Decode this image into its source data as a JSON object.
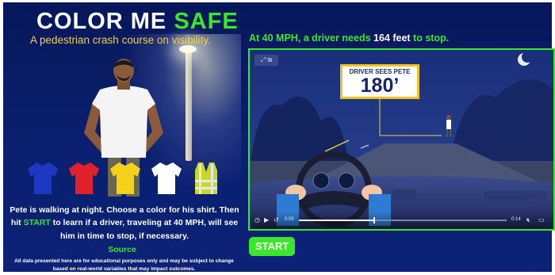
{
  "logo": {
    "text_main": "COLOR ME ",
    "text_accent": "SAFE"
  },
  "tagline": "A pedestrian crash course on visibility.",
  "swatches": [
    {
      "name": "blue",
      "color": "#1d39c4"
    },
    {
      "name": "red",
      "color": "#e0202a"
    },
    {
      "name": "yellow",
      "color": "#f4d11a"
    },
    {
      "name": "white",
      "color": "#ffffff"
    },
    {
      "name": "safety-vest",
      "color": "#c9d92c"
    }
  ],
  "instructions": {
    "part1": "Pete is walking at night. Choose a color for his shirt. Then hit ",
    "start_word": "START",
    "part2": " to learn if a driver, traveling at 40 MPH, will see him in time to stop, if necessary."
  },
  "source_link": "Source",
  "disclaimer": "All data presented here are for educational purposes only and may be subject to change based on real-world variables that may impact outcomes.",
  "headline": {
    "part1": "At 40 MPH, a driver needs ",
    "number": "164",
    "part2": " feet",
    "part3": " to stop."
  },
  "video": {
    "sign_label": "DRIVER SEES PETE",
    "sign_distance": "180’",
    "current_time": "0:05",
    "duration": "0:14",
    "progress": 0.36
  },
  "start_button": "START",
  "colors": {
    "accent_green": "#3be62b",
    "tagline_yellow": "#f3d13b",
    "background_navy": "#0a1f6e"
  }
}
